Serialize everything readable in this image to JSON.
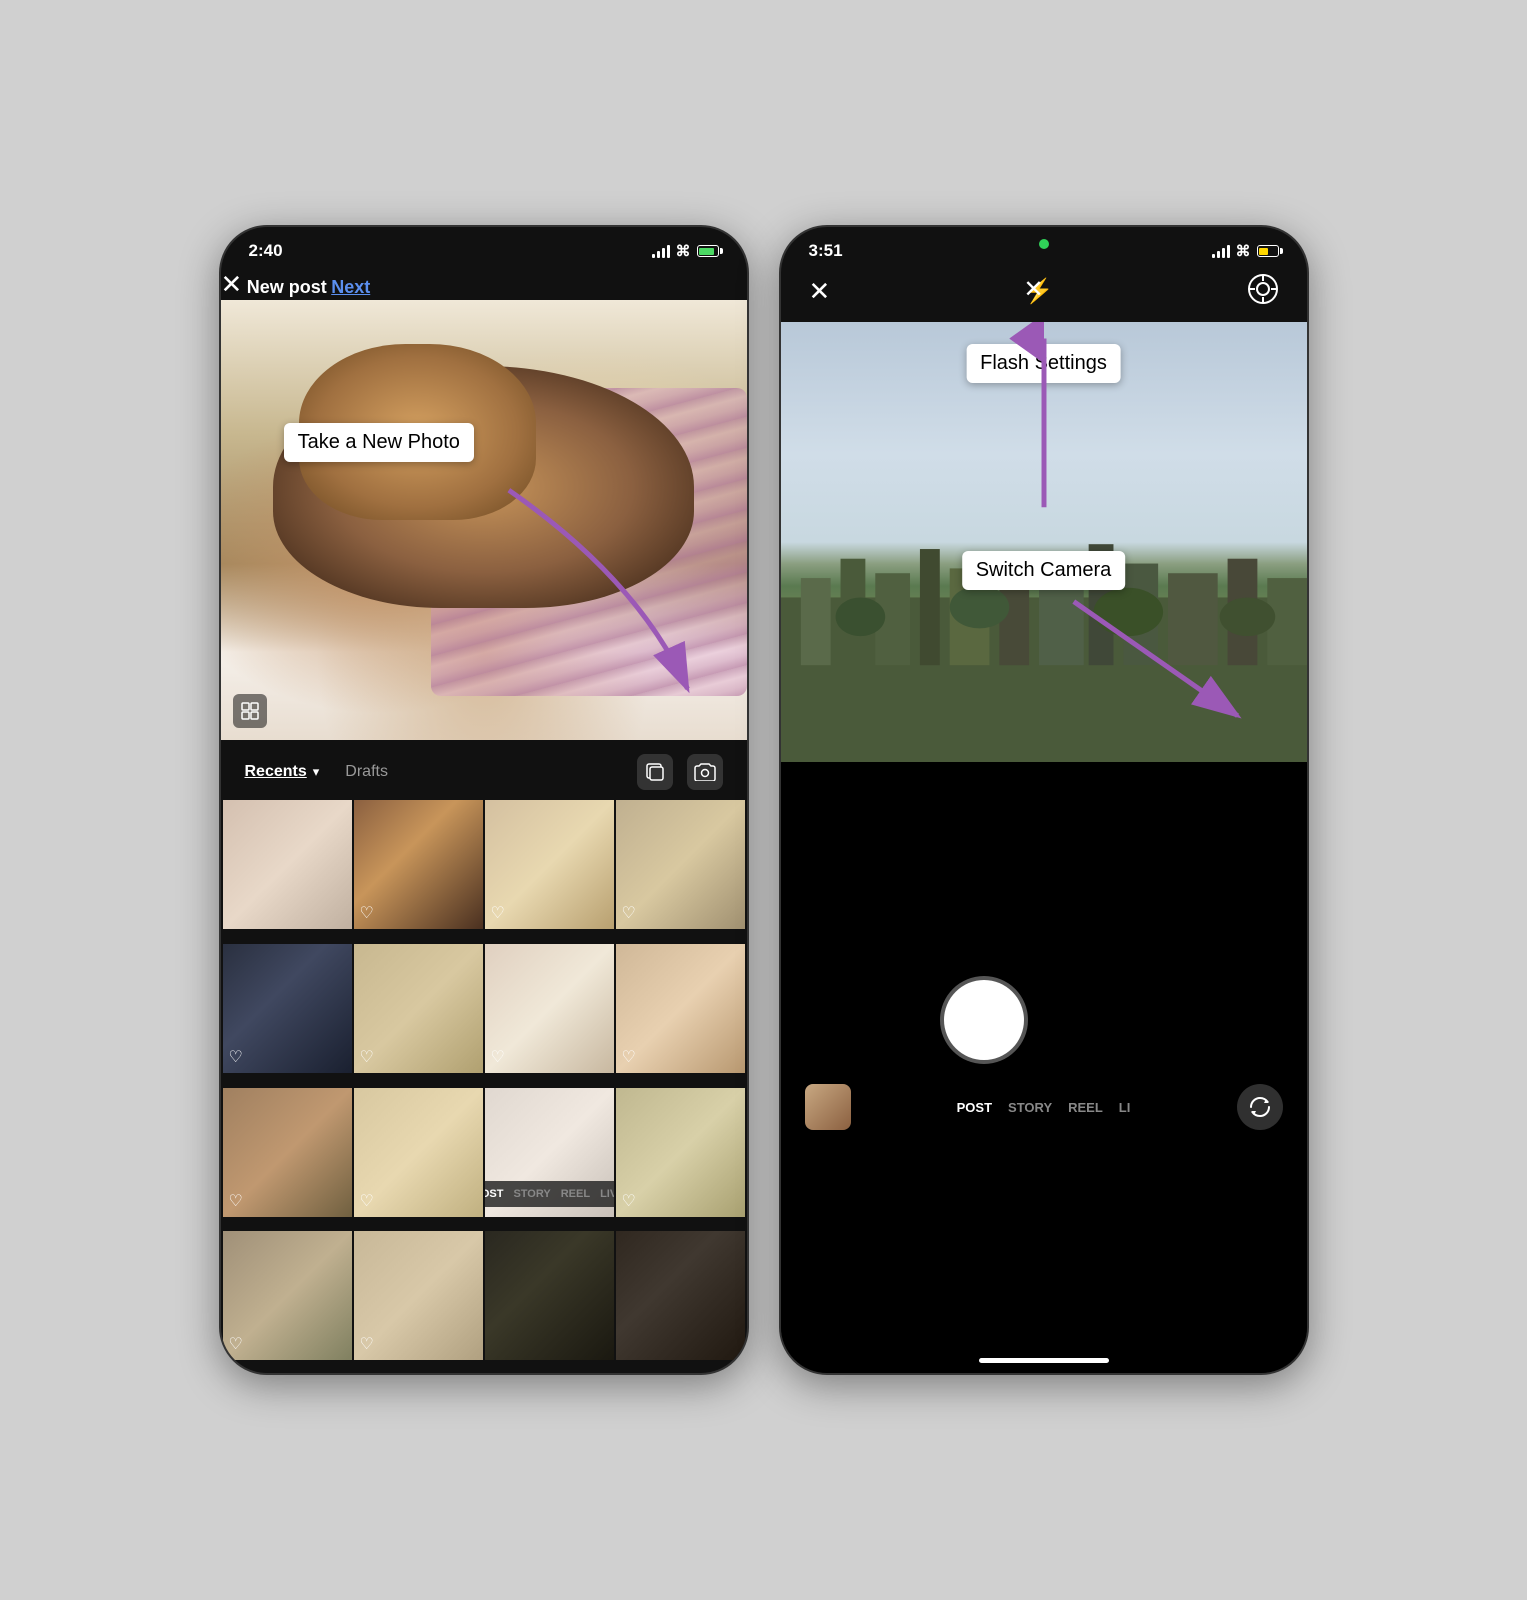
{
  "left_phone": {
    "status": {
      "time": "2:40",
      "signal": 4,
      "wifi": true,
      "battery": "charging"
    },
    "nav": {
      "close": "✕",
      "title": "New post",
      "next": "Next"
    },
    "annotation": {
      "take_photo": "Take a New Photo"
    },
    "library": {
      "recents": "Recents",
      "drafts": "Drafts"
    },
    "tabs": [
      "POST",
      "STORY",
      "REEL",
      "LIVE"
    ],
    "grid_count": 16
  },
  "right_phone": {
    "status": {
      "time": "3:51",
      "signal": 4,
      "wifi": true,
      "battery": "low"
    },
    "nav": {
      "close": "✕"
    },
    "annotations": {
      "flash_settings": "Flash Settings",
      "switch_camera": "Switch Camera"
    },
    "tabs": [
      "POST",
      "STORY",
      "REEL",
      "LIVE"
    ],
    "active_tab": "POST"
  },
  "colors": {
    "accent": "#5b8fef",
    "purple_arrow": "#9b59b6",
    "active_tab": "#ffffff",
    "inactive_tab": "#888888"
  }
}
